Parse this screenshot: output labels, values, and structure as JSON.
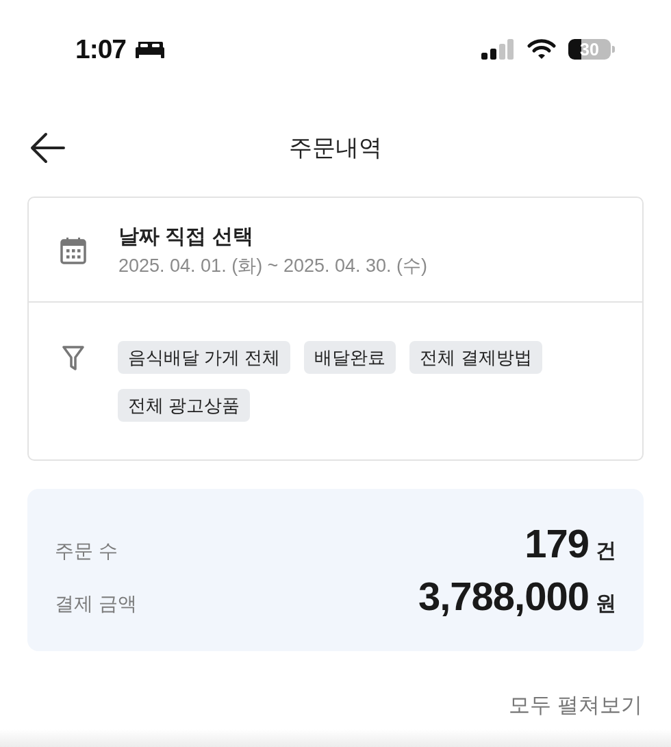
{
  "status_bar": {
    "time": "1:07",
    "battery": "30"
  },
  "header": {
    "title": "주문내역"
  },
  "date_filter": {
    "title": "날짜 직접 선택",
    "range": "2025. 04. 01. (화) ~ 2025. 04. 30. (수)"
  },
  "filter_chips": [
    {
      "label": "음식배달 가게 전체"
    },
    {
      "label": "배달완료"
    },
    {
      "label": "전체 결제방법"
    },
    {
      "label": "전체 광고상품"
    }
  ],
  "summary": [
    {
      "label": "주문 수",
      "value": "179",
      "unit": "건"
    },
    {
      "label": "결제 금액",
      "value": "3,788,000",
      "unit": "원"
    }
  ],
  "expand_all": "모두 펼쳐보기"
}
